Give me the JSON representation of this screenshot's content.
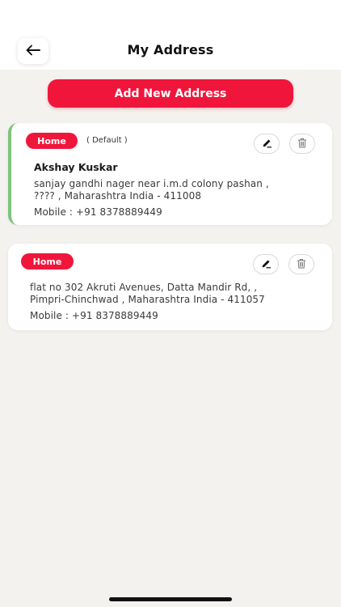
{
  "header": {
    "title": "My Address",
    "back_icon": "arrow-left-icon"
  },
  "add_button": {
    "label": "Add New Address"
  },
  "addresses": [
    {
      "tag": "Home",
      "default_label": "( Default )",
      "name": "Akshay Kuskar",
      "address_line_1": "sanjay gandhi nager near i.m.d colony pashan ,",
      "address_line_2": "???? , Maharashtra India - 411008",
      "mobile": "Mobile : +91 8378889449",
      "is_default": true
    },
    {
      "tag": "Home",
      "address_line_1": "flat no 302 Akruti Avenues, Datta Mandir Rd, ,",
      "address_line_2": "Pimpri-Chinchwad , Maharashtra India - 411057",
      "mobile": "Mobile : +91 8378889449",
      "is_default": false
    }
  ],
  "colors": {
    "accent": "#f0163b",
    "default_border": "#7fc37a",
    "background": "#f4f2ef"
  }
}
